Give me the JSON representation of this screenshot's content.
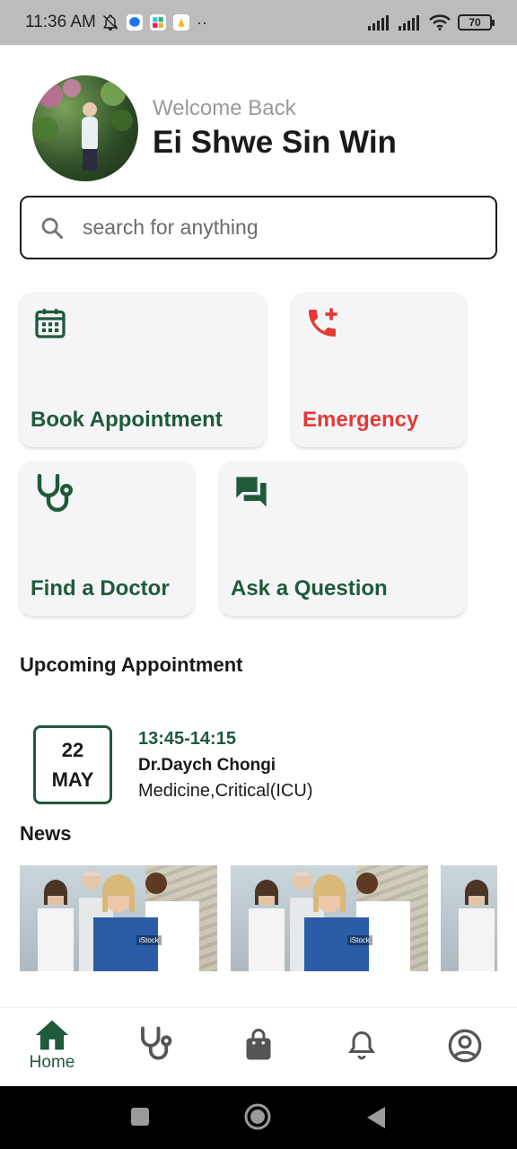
{
  "status_bar": {
    "time": "11:36 AM",
    "battery": "70"
  },
  "header": {
    "welcome": "Welcome Back",
    "username": "Ei Shwe Sin Win"
  },
  "search": {
    "placeholder": "search for anything",
    "icon": "search-icon"
  },
  "quick_actions": [
    {
      "label": "Book Appointment",
      "icon": "calendar-icon",
      "color": "#1f5a3a"
    },
    {
      "label": "Emergency",
      "icon": "phone-add-icon",
      "color": "#e53935"
    },
    {
      "label": "Find a Doctor",
      "icon": "stethoscope-icon",
      "color": "#1f5a3a"
    },
    {
      "label": "Ask a Question",
      "icon": "chat-icon",
      "color": "#1f5a3a"
    }
  ],
  "upcoming": {
    "title": "Upcoming Appointment",
    "day": "22",
    "month": "MAY",
    "time": "13:45-14:15",
    "doctor": "Dr.Daych Chongi",
    "department": "Medicine,Critical(ICU)"
  },
  "news": {
    "title": "News",
    "watermark": "iStock"
  },
  "bottom_nav": {
    "home_label": "Home",
    "items": [
      "home-icon",
      "stethoscope-icon",
      "bag-icon",
      "bell-icon",
      "account-icon"
    ]
  },
  "colors": {
    "primary": "#1f5a3a",
    "emergency": "#e53935"
  }
}
